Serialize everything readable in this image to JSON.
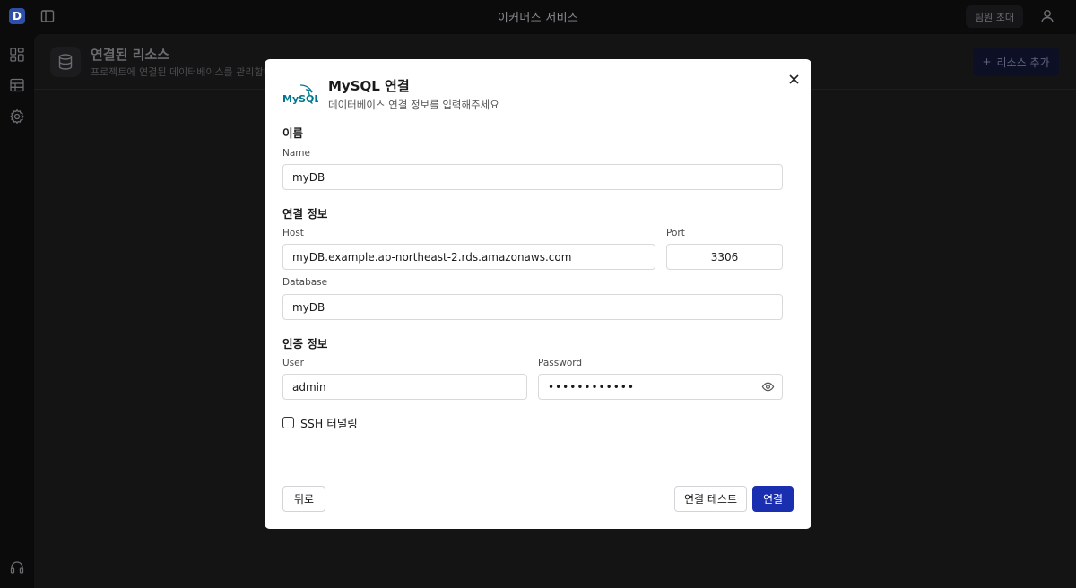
{
  "topbar": {
    "logo_letter": "D",
    "app_title": "이커머스 서비스",
    "invite_label": "팀원 초대"
  },
  "page": {
    "title": "연결된 리소스",
    "subtitle": "프로젝트에 연결된 데이터베이스를 관리합니",
    "add_label": "리소스 추가"
  },
  "modal": {
    "logo_text": "MySQL",
    "title": "MySQL 연결",
    "subtitle": "데이터베이스 연결 정보를 입력해주세요",
    "name_section": "이름",
    "name_label": "Name",
    "name_value": "myDB",
    "connection_section": "연결 정보",
    "host_label": "Host",
    "host_value": "myDB.example.ap-northeast-2.rds.amazonaws.com",
    "port_label": "Port",
    "port_value": "3306",
    "database_label": "Database",
    "database_value": "myDB",
    "auth_section": "인증 정보",
    "user_label": "User",
    "user_value": "admin",
    "password_label": "Password",
    "password_value": "••••••••••••",
    "ssh_label": "SSH 터널링",
    "ssh_checked": false,
    "back_label": "뒤로",
    "test_label": "연결 테스트",
    "connect_label": "연결"
  },
  "colors": {
    "primary": "#1a2fb0",
    "overlay": "#141414",
    "mysql_blue": "#00758f",
    "mysql_orange": "#f29111"
  }
}
